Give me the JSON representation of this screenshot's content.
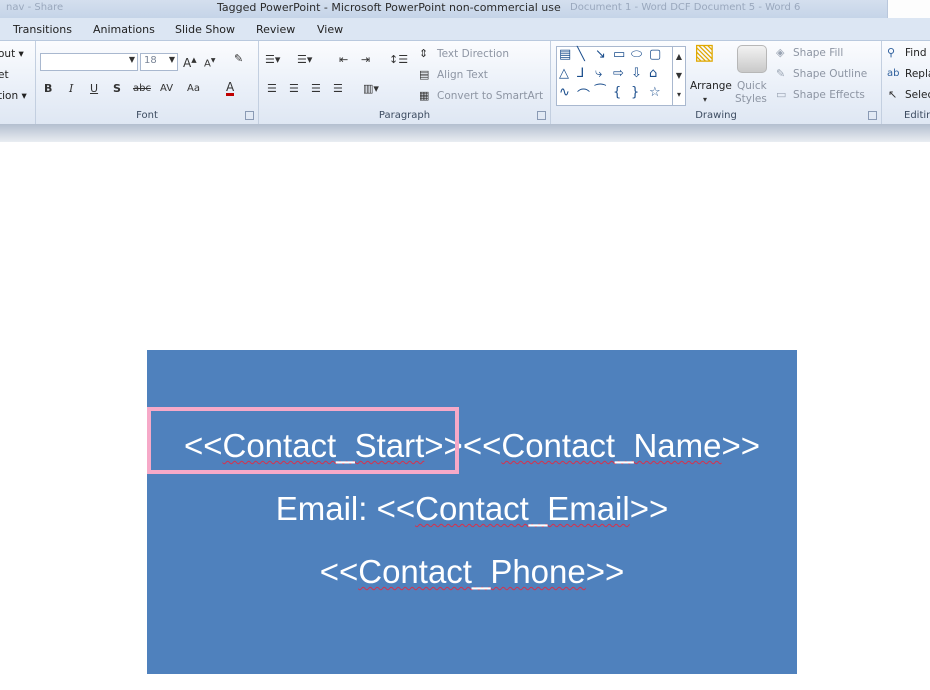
{
  "window": {
    "title": "Tagged PowerPoint  -  Microsoft PowerPoint non-commercial use",
    "faded_left": "nav - Share",
    "faded_right": "Document 1 - Word   DCF   Document 5 - Word 6"
  },
  "tabs": [
    "Transitions",
    "Animations",
    "Slide Show",
    "Review",
    "View"
  ],
  "ribbon": {
    "slides_partial": [
      "out ▾",
      "et",
      "tion ▾"
    ],
    "font": {
      "label": "Font",
      "font_name": "",
      "font_size": "18",
      "buttons": [
        "B",
        "I",
        "U",
        "S",
        "abc",
        "AV",
        "Aa",
        "A"
      ]
    },
    "paragraph": {
      "label": "Paragraph",
      "text_direction": "Text Direction",
      "align_text": "Align Text",
      "convert_smartart": "Convert to SmartArt"
    },
    "drawing": {
      "label": "Drawing",
      "arrange": "Arrange",
      "quick_styles_1": "Quick",
      "quick_styles_2": "Styles",
      "shape_fill": "Shape Fill",
      "shape_outline": "Shape Outline",
      "shape_effects": "Shape Effects"
    },
    "editing": {
      "label": "Editin",
      "find": "Find",
      "replace": "Repla",
      "select": "Selec"
    }
  },
  "slide": {
    "line1_start": "<<Contact_Start>>",
    "line1_name": "<<Contact_Name>>",
    "line2_prefix": "Email: ",
    "line2_field": "<<Contact_Email>>",
    "line3_field": "<<Contact_Phone>>"
  },
  "colors": {
    "shape_fill": "#4f81bd",
    "highlight": "#f6a9c8"
  }
}
